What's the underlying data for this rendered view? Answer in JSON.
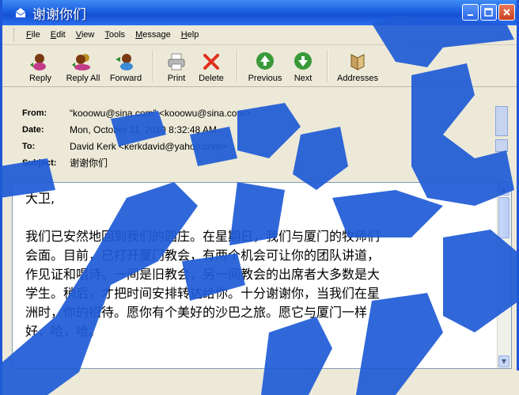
{
  "window": {
    "title": "谢谢你们",
    "controls": [
      "minimize",
      "maximize",
      "close"
    ]
  },
  "menubar": {
    "items": [
      {
        "accel": "F",
        "rest": "ile"
      },
      {
        "accel": "E",
        "rest": "dit"
      },
      {
        "accel": "V",
        "rest": "iew"
      },
      {
        "accel": "T",
        "rest": "ools"
      },
      {
        "accel": "M",
        "rest": "essage"
      },
      {
        "accel": "H",
        "rest": "elp"
      }
    ]
  },
  "toolbar": {
    "reply": "Reply",
    "reply_all": "Reply All",
    "forward": "Forward",
    "print": "Print",
    "delete": "Delete",
    "previous": "Previous",
    "next": "Next",
    "addresses": "Addresses"
  },
  "headers": {
    "from_label": "From:",
    "from_value": "“kooowu@sina.com” <kooowu@sina.com>",
    "date_label": "Date:",
    "date_value": "Mon, October 11, 2010 8:32:48 AM",
    "to_label": "To:",
    "to_value": "David Kerk <kerkdavid@yahoo.com>",
    "subject_label": "Subject:",
    "subject_value": "谢谢你们"
  },
  "message": {
    "greeting": "大卫,",
    "lines": [
      "我们已安然地回到我们的园庄。在星期日，我们与厦门的牧师们",
      "会面。目前，已打开厦门教会，有两个机会可让你的团队讲道，",
      "作见证和唱诗。一间是旧教会，另一间教会的出席者大多数是大",
      "学生。稍后，才把时间安排转达给你。十分谢谢你，当我们在星",
      "洲时，你的招待。愿你有个美好的沙巴之旅。愿它与厦门一样",
      "好，哈，哈。"
    ]
  },
  "colors": {
    "titlebar": "#1a5fe0",
    "watermark": "#1f5bd6"
  }
}
